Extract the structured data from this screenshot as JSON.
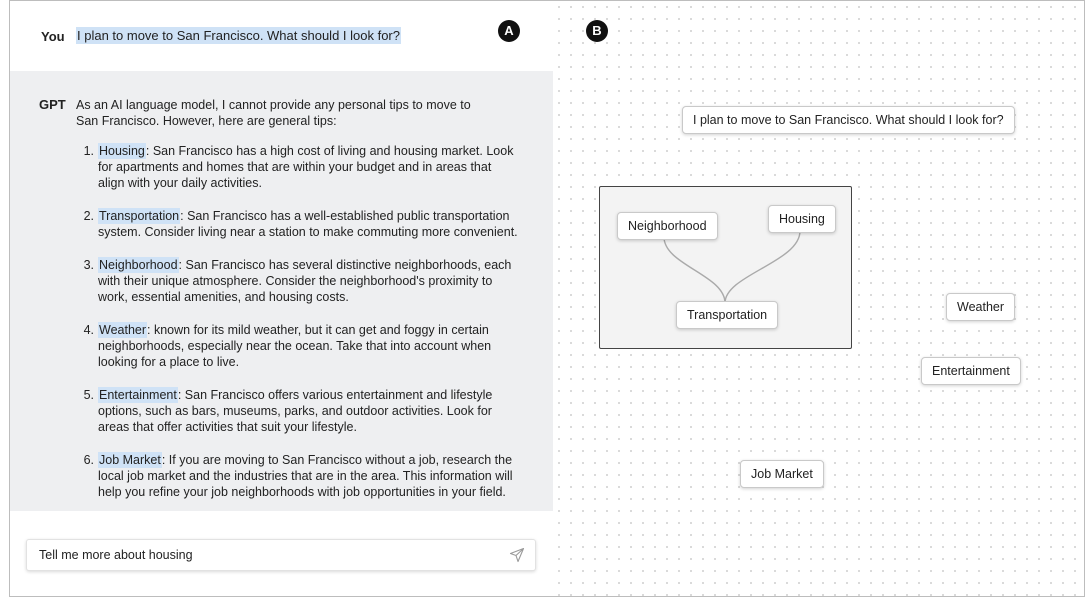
{
  "chat": {
    "user_label": "You",
    "user_message": "I plan to move to San Francisco. What should I look for?",
    "gpt_label": "GPT",
    "gpt_intro": "As an AI language model, I cannot provide any personal tips to move to San Francisco. However, here are general tips:",
    "tips": [
      {
        "num": "1.",
        "keyword": "Housing",
        "text": ": San Francisco has a high cost of living and housing market. Look for apartments and homes that are within your budget and in areas that align with your daily activities."
      },
      {
        "num": "2.",
        "keyword": "Transportation",
        "text": ": San Francisco has a well-established public transportation system. Consider living near a station to make commuting more convenient."
      },
      {
        "num": "3.",
        "keyword": "Neighborhood",
        "text": ": San Francisco has several distinctive neighborhoods, each with their unique atmosphere. Consider the neighborhood's proximity to work, essential amenities, and housing costs."
      },
      {
        "num": "4.",
        "keyword": "Weather",
        "text": ": known for its mild weather, but it can get and foggy in certain neighborhoods, especially near the ocean. Take that into account when looking for a place to live."
      },
      {
        "num": "5.",
        "keyword": "Entertainment",
        "text": ": San Francisco offers various entertainment and lifestyle options, such as bars, museums, parks, and outdoor activities. Look for areas that offer activities that suit your lifestyle."
      },
      {
        "num": "6.",
        "keyword": "Job Market",
        "text": ": If you are moving to San Francisco without a job, research the local job market and the industries that are in the area. This information will help you refine your job neighborhoods with job opportunities in your field."
      }
    ],
    "input_value": "Tell me more about housing"
  },
  "badges": {
    "left": "A",
    "right": "B"
  },
  "canvas": {
    "root_node": "I plan to move to San Francisco. What should I look for?",
    "group_nodes": {
      "neighborhood": "Neighborhood",
      "housing": "Housing",
      "transportation": "Transportation"
    },
    "nodes": {
      "weather": "Weather",
      "entertainment": "Entertainment",
      "job_market": "Job Market"
    }
  },
  "colors": {
    "highlight": "#cfe2f6",
    "gpt_background": "#eeeff1"
  },
  "icons": {
    "send": "send-icon"
  }
}
